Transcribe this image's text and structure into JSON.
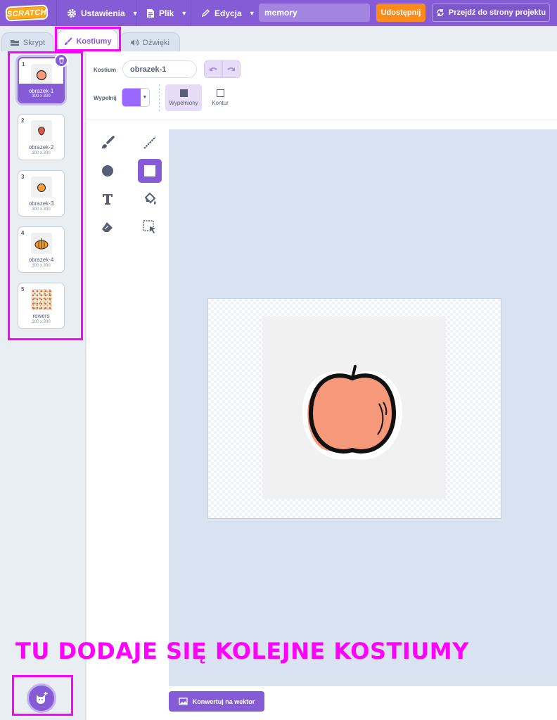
{
  "menu": {
    "logo": "SCRATCH",
    "settings": "Ustawienia",
    "file": "Plik",
    "edit": "Edycja",
    "project_title": "memory",
    "share": "Udostępnij",
    "see_project": "Przejdź do strony projektu"
  },
  "tabs": [
    {
      "label": "Skrypt"
    },
    {
      "label": "Kostiumy"
    },
    {
      "label": "Dźwięki"
    }
  ],
  "costumes": [
    {
      "num": "1",
      "name": "obrazek-1",
      "size": "300 x 300"
    },
    {
      "num": "2",
      "name": "obrazek-2",
      "size": "300 x 300"
    },
    {
      "num": "3",
      "name": "obrazek-3",
      "size": "300 x 300"
    },
    {
      "num": "4",
      "name": "obrazek-4",
      "size": "300 x 300"
    },
    {
      "num": "5",
      "name": "rewers",
      "size": "300 x 300"
    }
  ],
  "editor": {
    "costume_label": "Kostium",
    "costume_name": "obrazek-1",
    "fill_label": "Wypełnij",
    "fill_color": "#9966ff",
    "mode_filled": "Wypełniony",
    "mode_outline": "Kontur",
    "convert": "Konwertuj na wektor"
  },
  "annotation": "TU DODAJE SIĘ KOLEJNE KOSTIUMY",
  "colors": {
    "accent": "#855cd6",
    "highlight": "#ff00ff",
    "share": "#ff8c1a",
    "apple": "#f5997a"
  }
}
